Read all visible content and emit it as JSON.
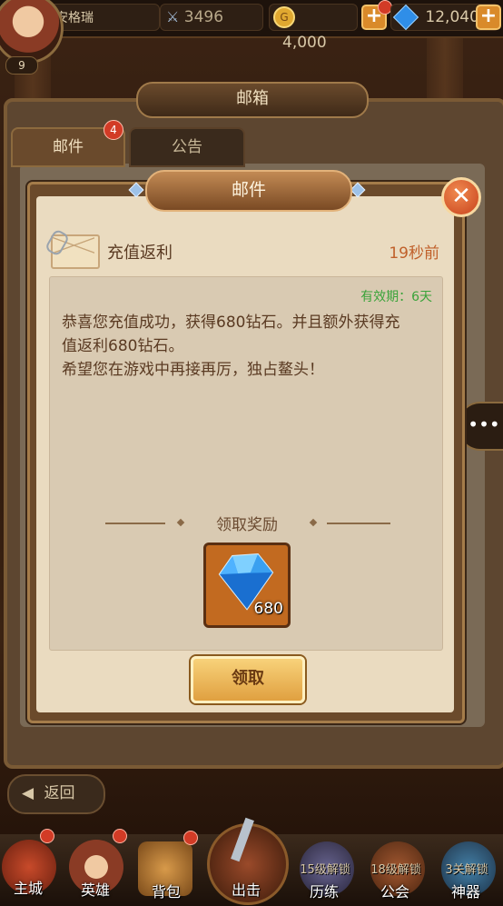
{
  "player": {
    "name": "安格瑞",
    "level": "9",
    "power": "3496",
    "gold": "4,000",
    "diamonds": "12,040"
  },
  "mailbox": {
    "title": "邮箱",
    "tabs": [
      {
        "label": "邮件",
        "badge": "4"
      },
      {
        "label": "公告"
      }
    ]
  },
  "mail": {
    "title": "邮件",
    "subject": "充值返利",
    "time": "19秒前",
    "validity": "有效期：6天",
    "body_line1": "恭喜您充值成功，获得680钻石。并且额外获得充",
    "body_line2": "值返利680钻石。",
    "body_line3": "希望您在游戏中再接再厉，独占鳌头！",
    "reward_label": "领取奖励",
    "reward": {
      "icon": "blue-diamond-icon",
      "quantity": "680"
    },
    "claim_label": "领取"
  },
  "back_label": "返回",
  "nav": {
    "items": [
      {
        "label": "主城"
      },
      {
        "label": "英雄"
      },
      {
        "label": "背包"
      },
      {
        "label": "出击"
      },
      {
        "label": "历练",
        "lock": "15级解锁"
      },
      {
        "label": "公会",
        "lock": "18级解锁"
      },
      {
        "label": "神器",
        "lock": "3关解锁"
      }
    ]
  },
  "colors": {
    "accent": "#c0602a",
    "validity": "#3aa33a",
    "panel": "#eadbc0"
  }
}
